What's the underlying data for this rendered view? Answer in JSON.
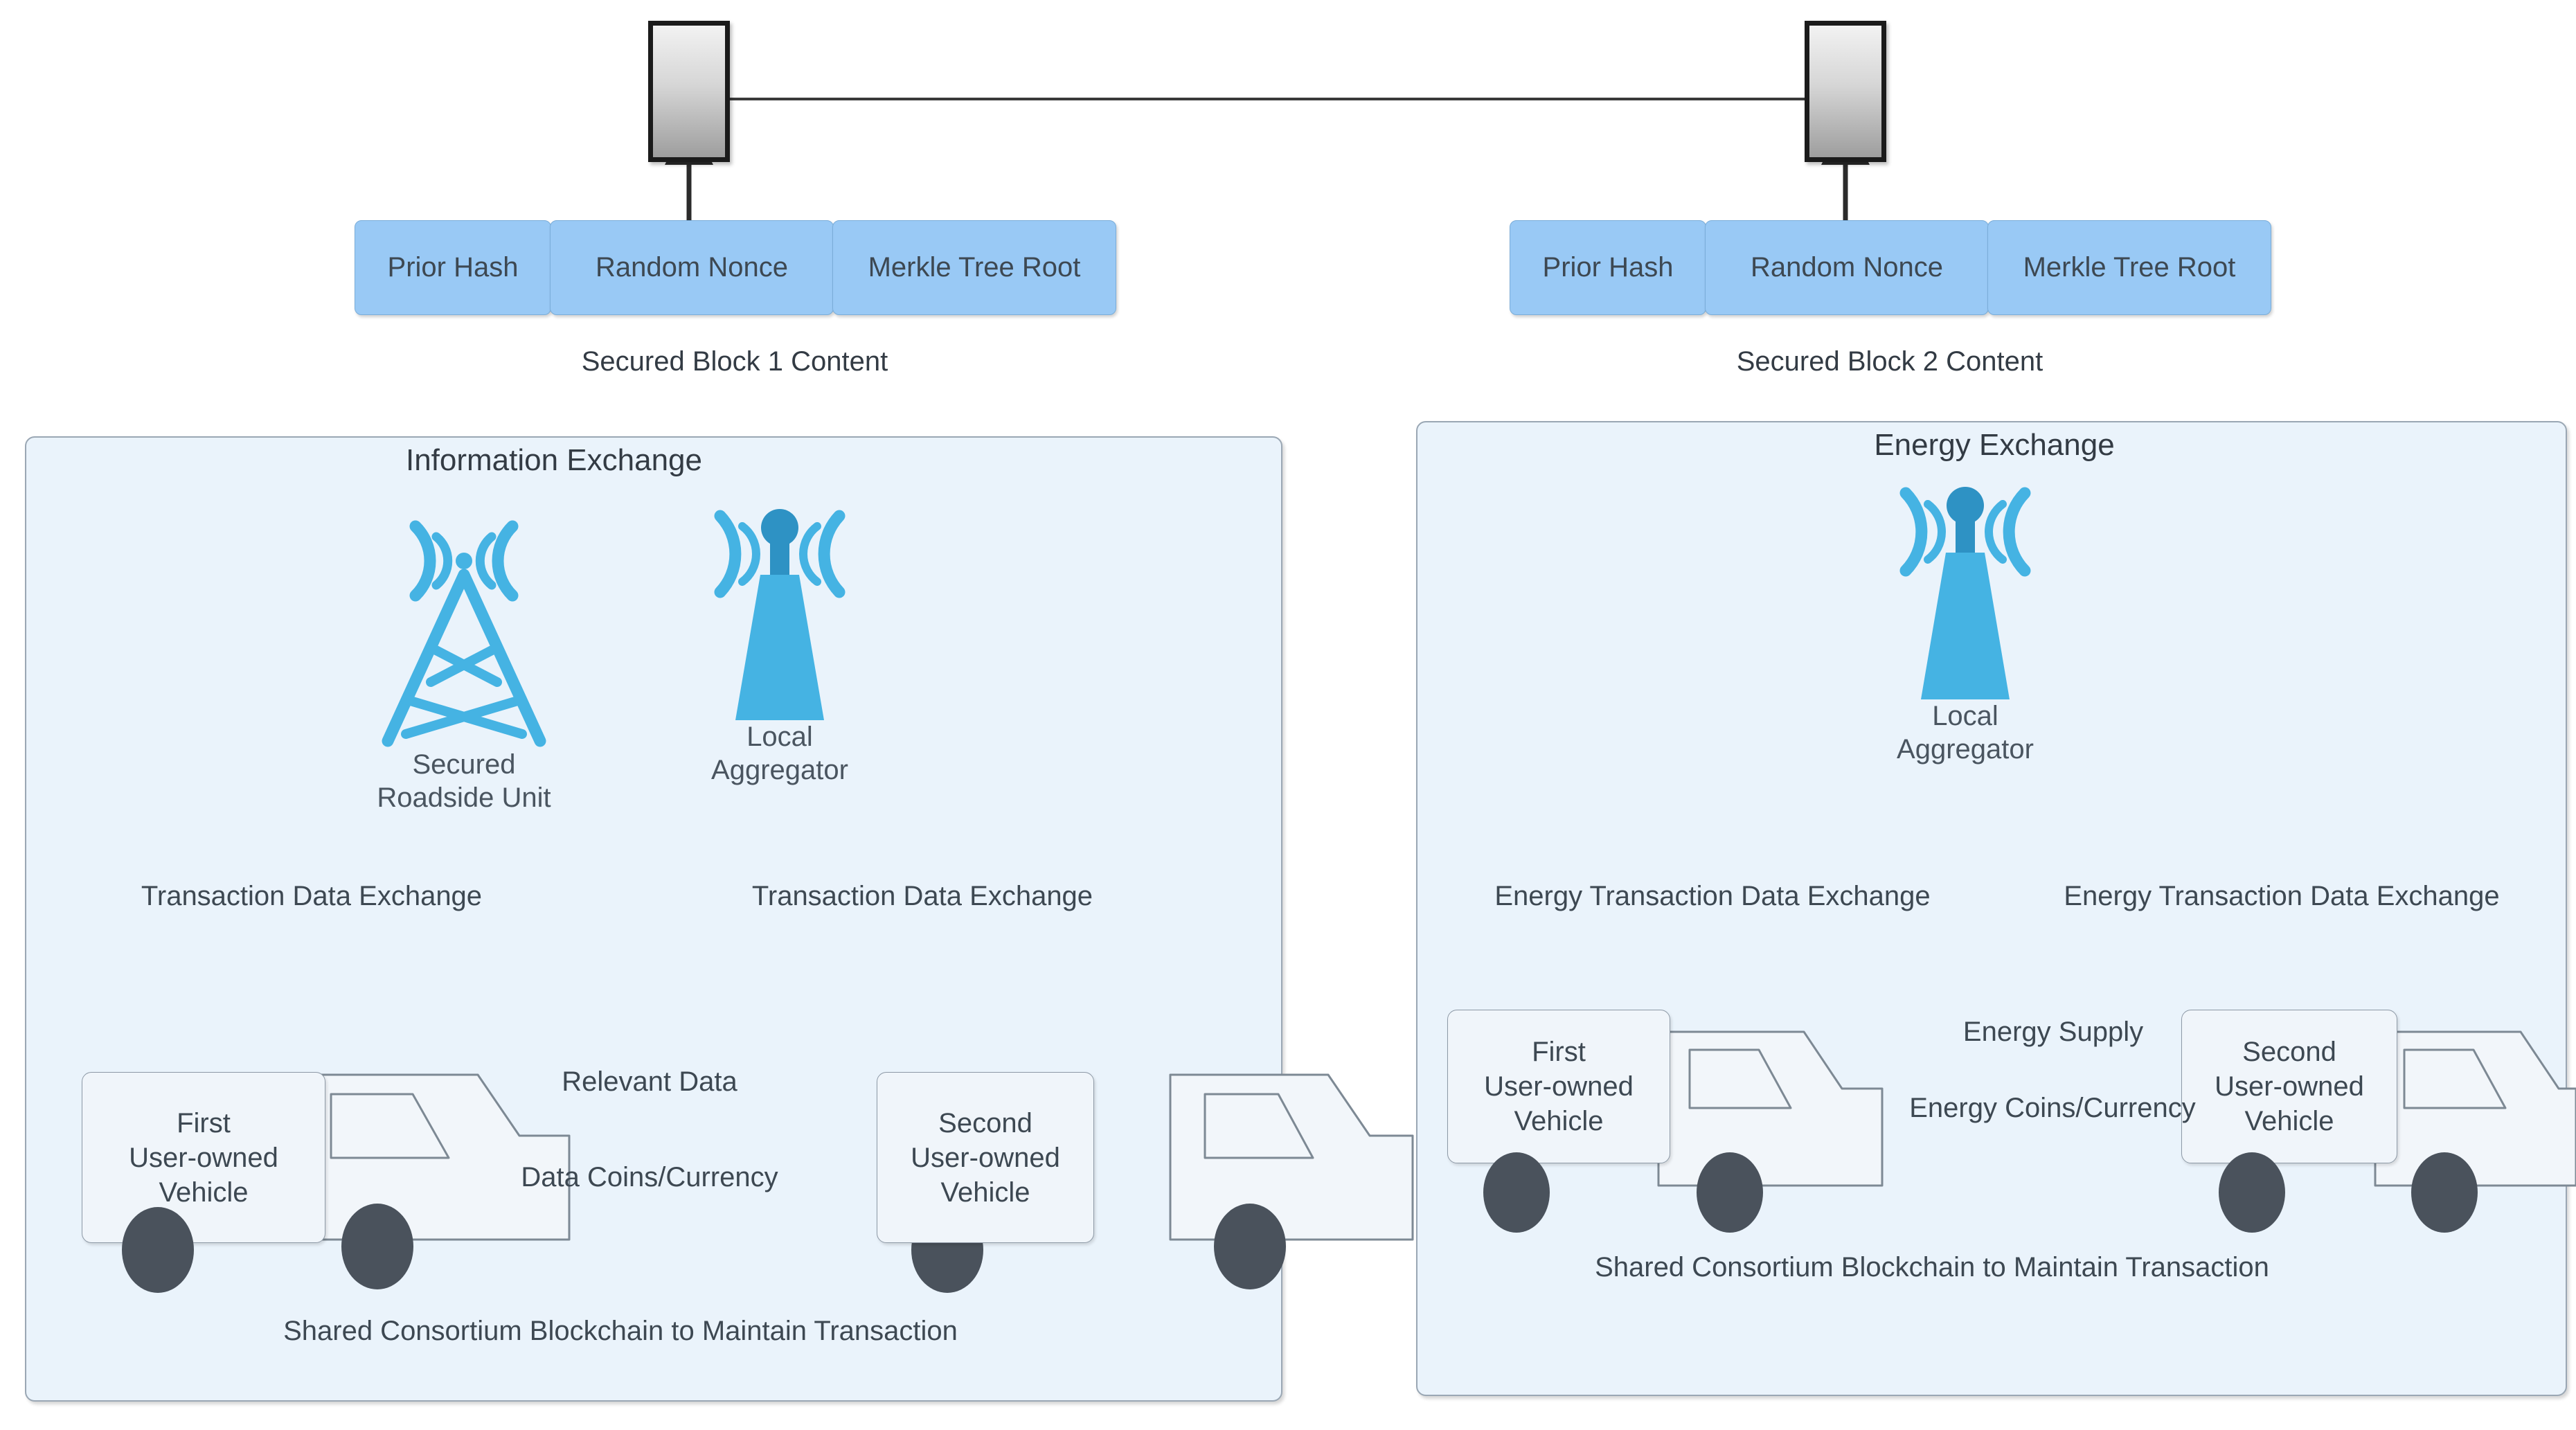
{
  "colors": {
    "panel_fill": "#eaf3fb",
    "panel_stroke": "#9aa7b4",
    "chip_fill": "#99c9f5",
    "chip_stroke": "#7aadd9",
    "icon_blue": "#45b3e3",
    "icon_blue_dark": "#2e92c4",
    "arrow": "#4a5560",
    "wheel": "#4a525c",
    "text": "#3d4852",
    "block_border": "#1b1b1b"
  },
  "blockchain": {
    "block1": {
      "caption": "Secured Block 1 Content",
      "fields": [
        "Prior Hash",
        "Random Nonce",
        "Merkle Tree Root"
      ]
    },
    "block2": {
      "caption": "Secured Block 2 Content",
      "fields": [
        "Prior Hash",
        "Random Nonce",
        "Merkle Tree Root"
      ]
    }
  },
  "information_panel": {
    "title": "Information Exchange",
    "rsu_label_line1": "Secured",
    "rsu_label_line2": "Roadside Unit",
    "aggregator_label_line1": "Local",
    "aggregator_label_line2": "Aggregator",
    "edge_rsu": "Transaction Data Exchange",
    "edge_aggregator": "Transaction Data Exchange",
    "vehicle1_line1": "First",
    "vehicle1_line2": "User-owned",
    "vehicle1_line3": "Vehicle",
    "vehicle2_line1": "Second",
    "vehicle2_line2": "User-owned",
    "vehicle2_line3": "Vehicle",
    "edge_forward": "Relevant Data",
    "edge_back": "Data Coins/Currency",
    "edge_bottom": "Shared Consortium Blockchain to Maintain Transaction"
  },
  "energy_panel": {
    "title": "Energy Exchange",
    "aggregator_label_line1": "Local",
    "aggregator_label_line2": "Aggregator",
    "edge_left": "Energy Transaction Data Exchange",
    "edge_right": "Energy Transaction Data Exchange",
    "vehicle1_line1": "First",
    "vehicle1_line2": "User-owned",
    "vehicle1_line3": "Vehicle",
    "vehicle2_line1": "Second",
    "vehicle2_line2": "User-owned",
    "vehicle2_line3": "Vehicle",
    "edge_forward": "Energy Supply",
    "edge_back": "Energy Coins/Currency",
    "edge_bottom": "Shared Consortium Blockchain to Maintain Transaction"
  },
  "icons": {
    "tower": "radio-tower-icon",
    "aggregator": "antenna-aggregator-icon",
    "vehicle": "truck-icon",
    "block": "blockchain-block-icon"
  }
}
